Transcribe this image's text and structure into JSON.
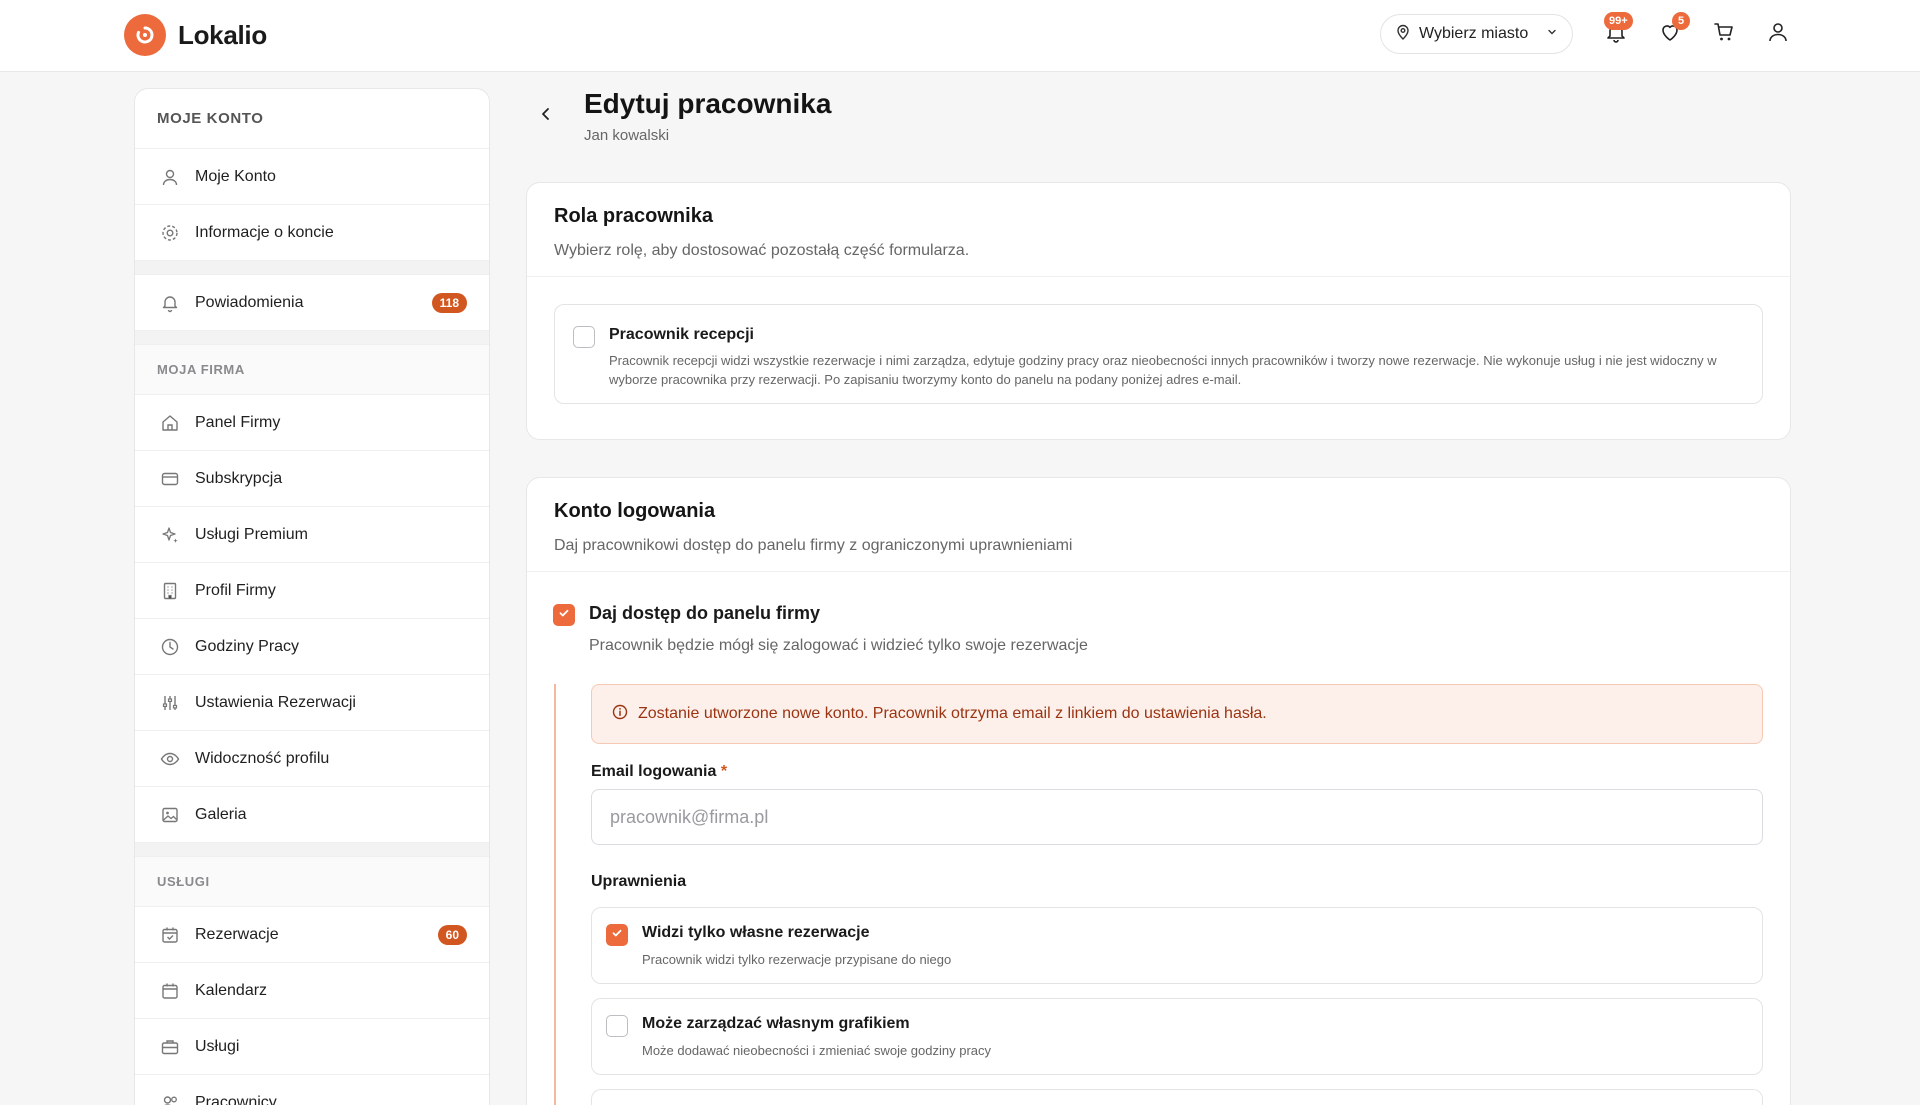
{
  "header": {
    "brand": "Lokalio",
    "city_label": "Wybierz miasto",
    "notifications_badge": "99+",
    "favorites_badge": "5"
  },
  "sidebar": {
    "title": "MOJE KONTO",
    "account_items": [
      {
        "label": "Moje Konto",
        "icon": "user-icon"
      },
      {
        "label": "Informacje o koncie",
        "icon": "gear-icon"
      }
    ],
    "notifications": {
      "label": "Powiadomienia",
      "icon": "bell-icon",
      "badge": "118"
    },
    "section_company": "MOJA FIRMA",
    "company_items": [
      {
        "label": "Panel Firmy",
        "icon": "home-icon"
      },
      {
        "label": "Subskrypcja",
        "icon": "credit-card-icon"
      },
      {
        "label": "Usługi Premium",
        "icon": "sparkles-icon"
      },
      {
        "label": "Profil Firmy",
        "icon": "building-icon"
      },
      {
        "label": "Godziny Pracy",
        "icon": "clock-icon"
      },
      {
        "label": "Ustawienia Rezerwacji",
        "icon": "sliders-icon"
      },
      {
        "label": "Widoczność profilu",
        "icon": "eye-icon"
      },
      {
        "label": "Galeria",
        "icon": "image-icon"
      }
    ],
    "section_services": "USŁUGI",
    "service_items": [
      {
        "label": "Rezerwacje",
        "icon": "calendar-check-icon",
        "badge": "60"
      },
      {
        "label": "Kalendarz",
        "icon": "calendar-icon"
      },
      {
        "label": "Usługi",
        "icon": "briefcase-icon"
      },
      {
        "label": "Pracownicy",
        "icon": "users-icon"
      }
    ]
  },
  "page": {
    "title": "Edytuj pracownika",
    "subtitle": "Jan kowalski"
  },
  "role_card": {
    "title": "Rola pracownika",
    "desc": "Wybierz rolę, aby dostosować pozostałą część formularza.",
    "option": {
      "title": "Pracownik recepcji",
      "desc": "Pracownik recepcji widzi wszystkie rezerwacje i nimi zarządza, edytuje godziny pracy oraz nieobecności innych pracowników i tworzy nowe rezerwacje. Nie wykonuje usług i nie jest widoczny w wyborze pracownika przy rezerwacji. Po zapisaniu tworzymy konto do panelu na podany poniżej adres e-mail.",
      "checked": false
    }
  },
  "login_card": {
    "title": "Konto logowania",
    "desc": "Daj pracownikowi dostęp do panelu firmy z ograniczonymi uprawnieniami",
    "access": {
      "title": "Daj dostęp do panelu firmy",
      "desc": "Pracownik będzie mógł się zalogować i widzieć tylko swoje rezerwacje",
      "checked": true
    },
    "alert": "Zostanie utworzone nowe konto. Pracownik otrzyma email z linkiem do ustawienia hasła.",
    "email_label": "Email logowania",
    "email_required_mark": "*",
    "email_placeholder": "pracownik@firma.pl",
    "permissions_label": "Uprawnienia",
    "permissions": [
      {
        "title": "Widzi tylko własne rezerwacje",
        "desc": "Pracownik widzi tylko rezerwacje przypisane do niego",
        "checked": true
      },
      {
        "title": "Może zarządzać własnym grafikiem",
        "desc": "Może dodawać nieobecności i zmieniać swoje godziny pracy",
        "checked": false
      }
    ]
  },
  "colors": {
    "accent": "#ec6a3c",
    "badge": "#d2561f",
    "alert_bg": "#fdf0ea",
    "alert_text": "#9a3412"
  }
}
